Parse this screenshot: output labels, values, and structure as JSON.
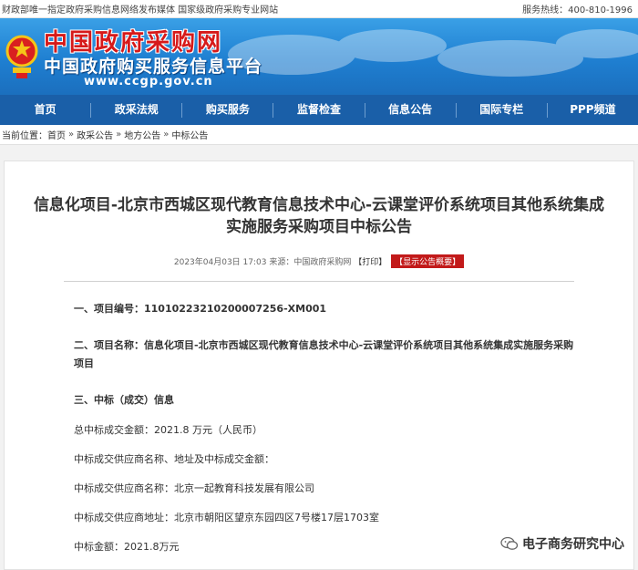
{
  "topbar": {
    "left_text": "财政部唯一指定政府采购信息网络发布媒体 国家级政府采购专业网站",
    "hotline": "服务热线：400-810-1996"
  },
  "banner": {
    "site_name": "中国政府采购网",
    "site_subtitle": "中国政府购买服务信息平台",
    "url": "www.ccgp.gov.cn"
  },
  "nav": {
    "items": [
      "首页",
      "政采法规",
      "购买服务",
      "监督检查",
      "信息公告",
      "国际专栏",
      "PPP频道"
    ]
  },
  "breadcrumb": {
    "prefix": "当前位置：",
    "items": [
      "首页",
      "政采公告",
      "地方公告",
      "中标公告"
    ],
    "separator": "»"
  },
  "article": {
    "title_line1": "信息化项目-北京市西城区现代教育信息技术中心-云课堂评价系统项目其他系统集成",
    "title_line2": "实施服务采购项目中标公告",
    "meta": "2023年04月03日 17:03 来源：中国政府采购网",
    "print_label": "【打印】",
    "summary_button": "【显示公告概要】",
    "section1": "一、项目编号：11010223210200007256-XM001",
    "section2_line1": "二、项目名称：信息化项目-北京市西城区现代教育信息技术中心-云课堂评价系统项目其他系统集成实施服务采购",
    "section2_line2": "项目",
    "section3": "三、中标（成交）信息",
    "total_amount": "总中标成交金额：2021.8 万元（人民币）",
    "supplier_header": "中标成交供应商名称、地址及中标成交金额：",
    "supplier_name": "中标成交供应商名称：北京一起教育科技发展有限公司",
    "supplier_address": "中标成交供应商地址：北京市朝阳区望京东园四区7号楼17层1703室",
    "bid_amount": "中标金额：2021.8万元"
  },
  "watermark": {
    "text": "电子商务研究中心"
  },
  "colors": {
    "nav_bg": "#1a5fa8",
    "brand_red": "#d61a1a",
    "summary_red": "#c21a1a"
  }
}
